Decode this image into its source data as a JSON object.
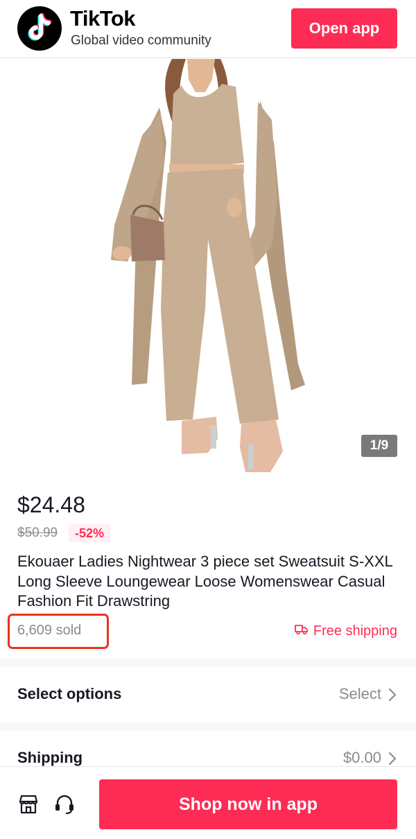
{
  "header": {
    "brand_name": "TikTok",
    "tagline": "Global video community",
    "open_app_label": "Open app"
  },
  "gallery": {
    "counter": "1/9"
  },
  "product": {
    "price": "$24.48",
    "original_price": "$50.99",
    "discount": "-52%",
    "title": "Ekouaer Ladies Nightwear 3 piece set Sweatsuit S-XXL Long Sleeve Loungewear Loose Womenswear Casual Fashion Fit Drawstring",
    "sold": "6,609 sold",
    "free_shipping": "Free shipping"
  },
  "options": {
    "label": "Select options",
    "value": "Select"
  },
  "shipping": {
    "label": "Shipping",
    "value": "$0.00"
  },
  "bottom_bar": {
    "shop_now_label": "Shop now in app"
  },
  "colors": {
    "accent": "#fe2c55",
    "highlight_box": "#e8331e",
    "garment": "#c7ae93"
  },
  "icons": [
    "tiktok-logo-icon",
    "truck-icon",
    "chevron-right-icon",
    "store-icon",
    "headset-icon"
  ]
}
